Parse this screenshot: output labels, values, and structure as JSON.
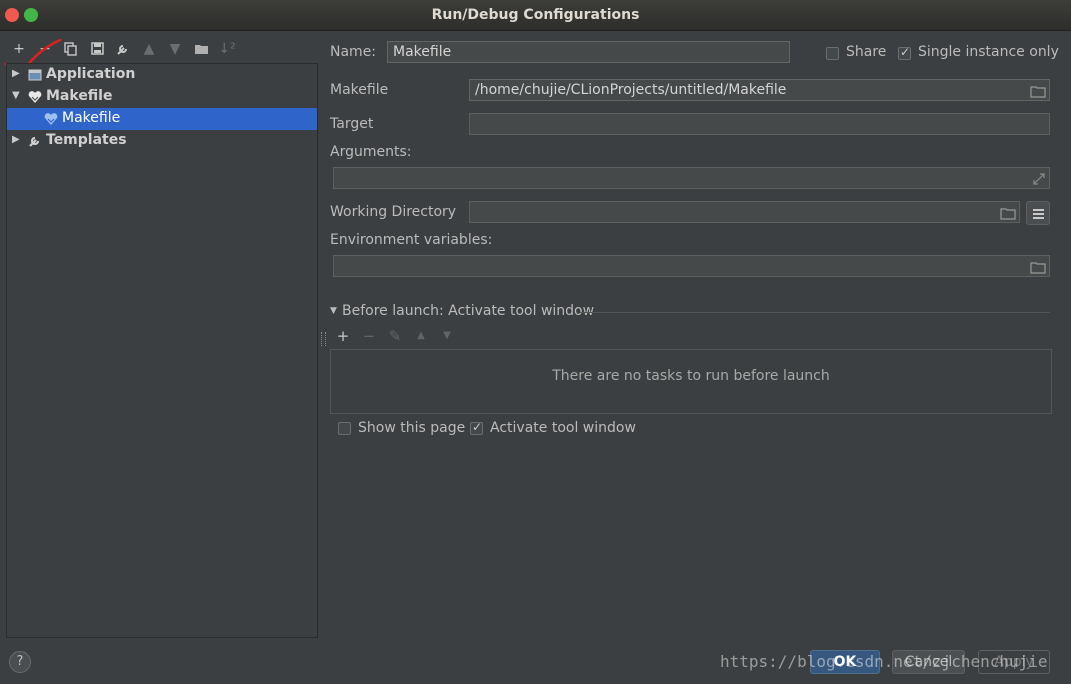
{
  "window": {
    "title": "Run/Debug Configurations"
  },
  "toolbar": {
    "icons": [
      "add-icon",
      "remove-icon",
      "copy-icon",
      "save-icon",
      "wrench-icon",
      "move-up-icon",
      "move-down-icon",
      "folder-icon",
      "sort-icon"
    ]
  },
  "tree": {
    "items": [
      {
        "label": "Application",
        "expanded": false,
        "bold": true,
        "icon": "application-icon"
      },
      {
        "label": "Makefile",
        "expanded": true,
        "bold": true,
        "icon": "makefile-icon"
      },
      {
        "label": "Makefile",
        "selected": true,
        "icon": "makefile-icon"
      },
      {
        "label": "Templates",
        "expanded": false,
        "bold": true,
        "icon": "wrench-icon"
      }
    ]
  },
  "form": {
    "name_label": "Name:",
    "name_value": "Makefile",
    "share_label": "Share",
    "share_checked": false,
    "single_instance_label": "Single instance only",
    "single_instance_checked": true,
    "makefile_label": "Makefile",
    "makefile_value": "/home/chujie/CLionProjects/untitled/Makefile",
    "target_label": "Target",
    "target_value": "",
    "arguments_label": "Arguments:",
    "arguments_value": "",
    "working_dir_label": "Working Directory",
    "working_dir_value": "",
    "env_label": "Environment variables:",
    "env_value": ""
  },
  "before_launch": {
    "header": "Before launch: Activate tool window",
    "empty_text": "There are no tasks to run before launch",
    "show_page_label": "Show this page",
    "show_page_checked": false,
    "activate_label": "Activate tool window",
    "activate_checked": true
  },
  "buttons": {
    "help": "?",
    "ok": "OK",
    "cancel": "Cancel",
    "apply": "Apply"
  },
  "watermark": "https://blog.csdn.net/zjchenchujie",
  "colors": {
    "selection": "#2f65ca",
    "background": "#3c3f41",
    "ok_button": "#365880"
  }
}
